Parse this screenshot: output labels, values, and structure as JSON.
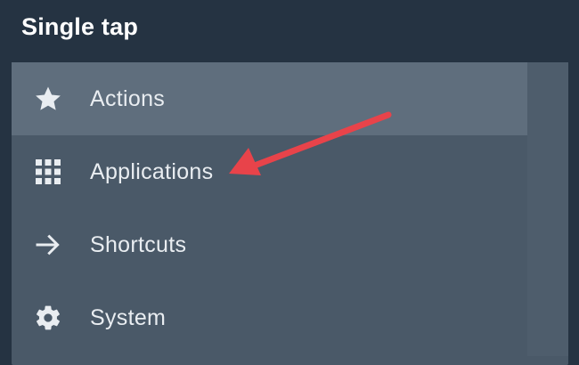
{
  "header": {
    "title": "Single tap"
  },
  "menu": {
    "items": [
      {
        "label": "Actions",
        "icon": "star-icon",
        "selected": true
      },
      {
        "label": "Applications",
        "icon": "grid-icon",
        "selected": false
      },
      {
        "label": "Shortcuts",
        "icon": "arrow-right-icon",
        "selected": false
      },
      {
        "label": "System",
        "icon": "gear-icon",
        "selected": false
      }
    ]
  },
  "colors": {
    "background": "#253342",
    "panel": "#4a5968",
    "selected_row": "#5f6e7d",
    "text": "#e9edf1",
    "annotation_arrow": "#e8434a"
  }
}
